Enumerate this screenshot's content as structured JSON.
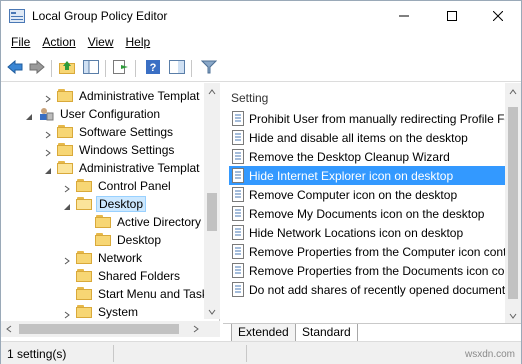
{
  "window": {
    "title": "Local Group Policy Editor",
    "controls": {
      "minimize": "minimize",
      "maximize": "maximize",
      "close": "close"
    }
  },
  "menu": {
    "items": [
      {
        "label": "File",
        "accel": "F"
      },
      {
        "label": "Action",
        "accel": "A"
      },
      {
        "label": "View",
        "accel": "V"
      },
      {
        "label": "Help",
        "accel": "H"
      }
    ]
  },
  "toolbar": {
    "buttons": [
      "back-arrow-icon",
      "forward-arrow-icon",
      "up-folder-icon",
      "show-hide-tree-icon",
      "export-list-icon",
      "help-icon",
      "properties-pane-icon",
      "filter-icon"
    ]
  },
  "tree": {
    "items": [
      {
        "label": "Administrative Templat",
        "level": 1,
        "arrow": "collapsed"
      },
      {
        "label": "User Configuration",
        "level": 0,
        "arrow": "expanded"
      },
      {
        "label": "Software Settings",
        "level": 1,
        "arrow": "collapsed"
      },
      {
        "label": "Windows Settings",
        "level": 1,
        "arrow": "collapsed"
      },
      {
        "label": "Administrative Templat",
        "level": 1,
        "arrow": "expanded"
      },
      {
        "label": "Control Panel",
        "level": 2,
        "arrow": "collapsed"
      },
      {
        "label": "Desktop",
        "level": 2,
        "arrow": "expanded",
        "selected": true
      },
      {
        "label": "Active Directory",
        "level": 3,
        "arrow": "none"
      },
      {
        "label": "Desktop",
        "level": 3,
        "arrow": "none"
      },
      {
        "label": "Network",
        "level": 2,
        "arrow": "collapsed"
      },
      {
        "label": "Shared Folders",
        "level": 2,
        "arrow": "none"
      },
      {
        "label": "Start Menu and Task",
        "level": 2,
        "arrow": "none"
      },
      {
        "label": "System",
        "level": 2,
        "arrow": "collapsed"
      }
    ]
  },
  "settings": {
    "column_header": "Setting",
    "rows": [
      {
        "label": "Prohibit User from manually redirecting Profile Fold"
      },
      {
        "label": "Hide and disable all items on the desktop"
      },
      {
        "label": "Remove the Desktop Cleanup Wizard"
      },
      {
        "label": "Hide Internet Explorer icon on desktop",
        "selected": true
      },
      {
        "label": "Remove Computer icon on the desktop"
      },
      {
        "label": "Remove My Documents icon on the desktop"
      },
      {
        "label": "Hide Network Locations icon on desktop"
      },
      {
        "label": "Remove Properties from the Computer icon contex"
      },
      {
        "label": "Remove Properties from the Documents icon contex"
      },
      {
        "label": "Do not add shares of recently opened documents to"
      }
    ]
  },
  "tabs": [
    {
      "label": "Extended",
      "active": false
    },
    {
      "label": "Standard",
      "active": true
    }
  ],
  "status": {
    "text": "1 setting(s)",
    "watermark": "wsxdn.com"
  },
  "colors": {
    "selection_blue": "#3399ff",
    "tree_selection": "#cce8ff",
    "folder": "#f7d674"
  }
}
